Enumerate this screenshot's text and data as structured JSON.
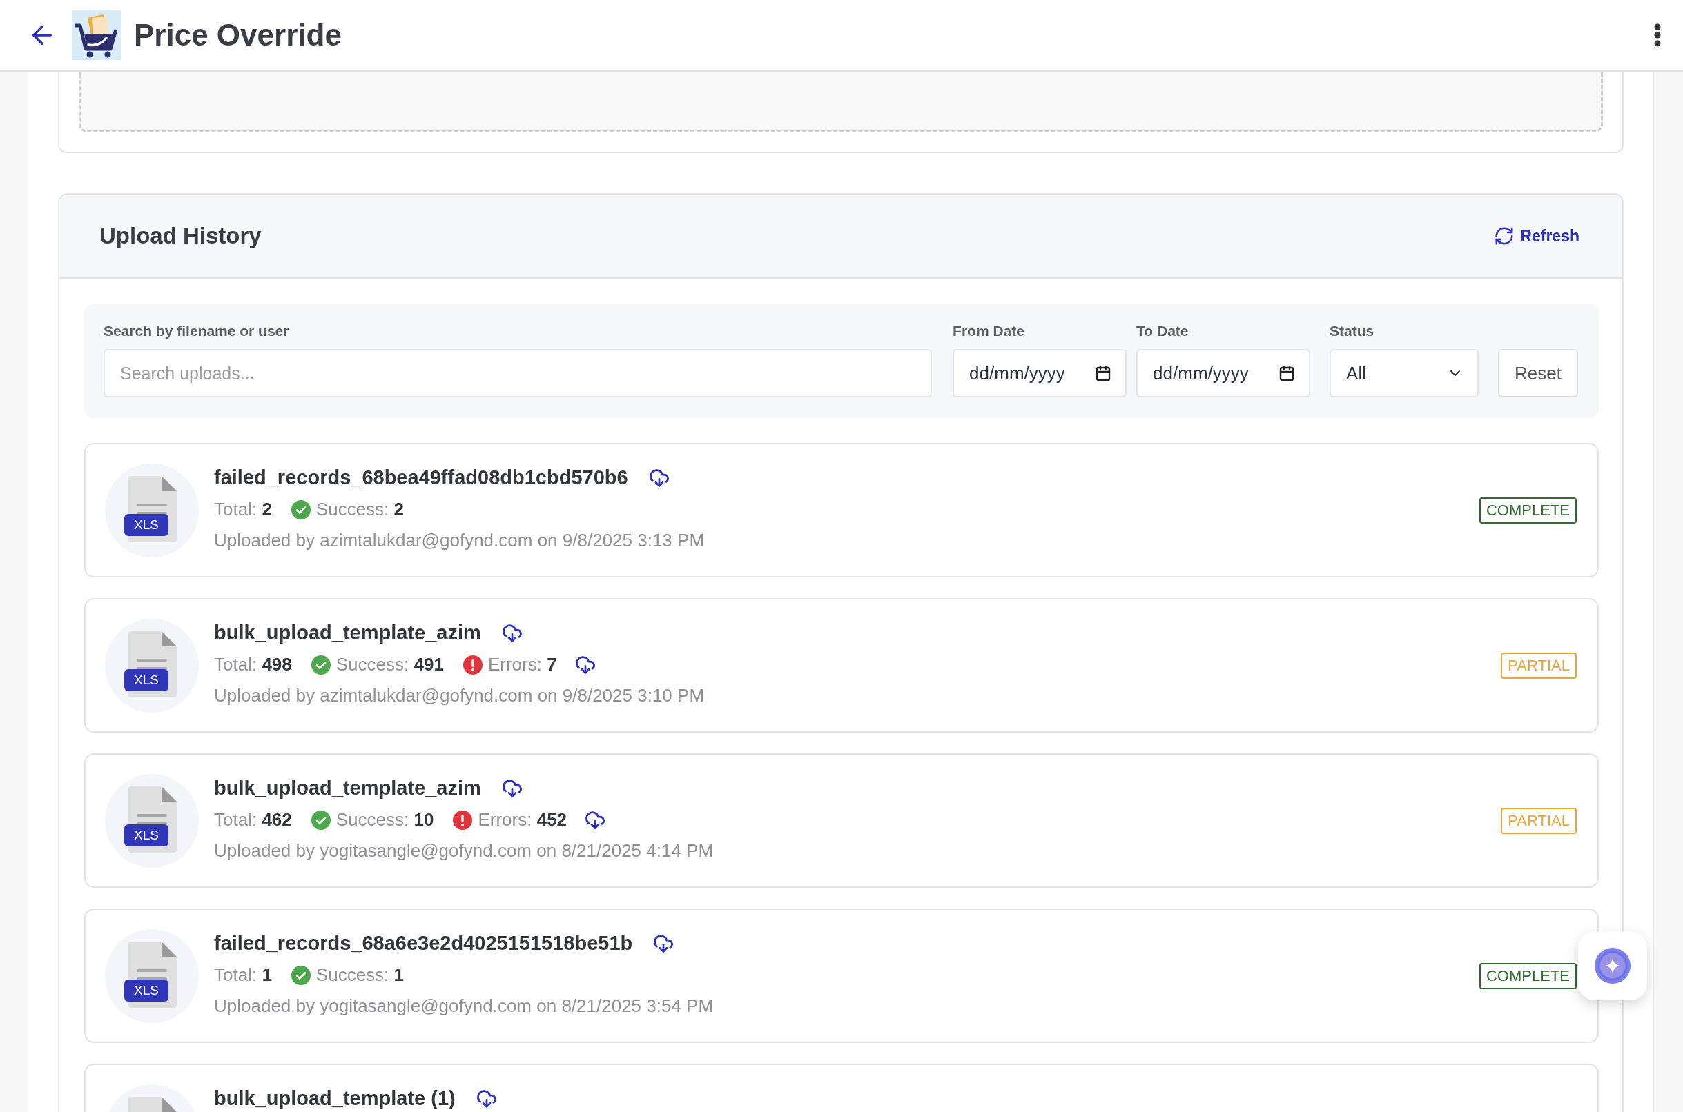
{
  "header": {
    "title": "Price Override"
  },
  "upload_history": {
    "title": "Upload History",
    "refresh": "Refresh",
    "filters": {
      "search": {
        "label": "Search by filename or user",
        "placeholder": "Search uploads..."
      },
      "from_date": {
        "label": "From Date",
        "value": "dd/mm/yyyy"
      },
      "to_date": {
        "label": "To Date",
        "value": "dd/mm/yyyy"
      },
      "status": {
        "label": "Status",
        "value": "All"
      },
      "reset": "Reset"
    },
    "uploads": [
      {
        "file_type": "XLS",
        "file_name": "failed_records_68bea49ffad08db1cbd570b6",
        "stats": [
          {
            "kind": "total",
            "label": "Total:",
            "value": "2"
          },
          {
            "kind": "success",
            "label": "Success:",
            "value": "2"
          }
        ],
        "uploaded": "Uploaded by azimtalukdar@gofynd.com on 9/8/2025 3:13 PM",
        "status": {
          "kind": "complete",
          "label": "COMPLETE"
        }
      },
      {
        "file_type": "XLS",
        "file_name": "bulk_upload_template_azim",
        "stats": [
          {
            "kind": "total",
            "label": "Total:",
            "value": "498"
          },
          {
            "kind": "success",
            "label": "Success:",
            "value": "491"
          },
          {
            "kind": "errors",
            "label": "Errors:",
            "value": "7"
          }
        ],
        "uploaded": "Uploaded by azimtalukdar@gofynd.com on 9/8/2025 3:10 PM",
        "status": {
          "kind": "partial",
          "label": "PARTIAL"
        }
      },
      {
        "file_type": "XLS",
        "file_name": "bulk_upload_template_azim",
        "stats": [
          {
            "kind": "total",
            "label": "Total:",
            "value": "462"
          },
          {
            "kind": "success",
            "label": "Success:",
            "value": "10"
          },
          {
            "kind": "errors",
            "label": "Errors:",
            "value": "452"
          }
        ],
        "uploaded": "Uploaded by yogitasangle@gofynd.com on 8/21/2025 4:14 PM",
        "status": {
          "kind": "partial",
          "label": "PARTIAL"
        }
      },
      {
        "file_type": "XLS",
        "file_name": "failed_records_68a6e3e2d4025151518be51b",
        "stats": [
          {
            "kind": "total",
            "label": "Total:",
            "value": "1"
          },
          {
            "kind": "success",
            "label": "Success:",
            "value": "1"
          }
        ],
        "uploaded": "Uploaded by yogitasangle@gofynd.com on 8/21/2025 3:54 PM",
        "status": {
          "kind": "complete",
          "label": "COMPLETE"
        }
      },
      {
        "file_name": "bulk_upload_template (1)"
      }
    ]
  }
}
